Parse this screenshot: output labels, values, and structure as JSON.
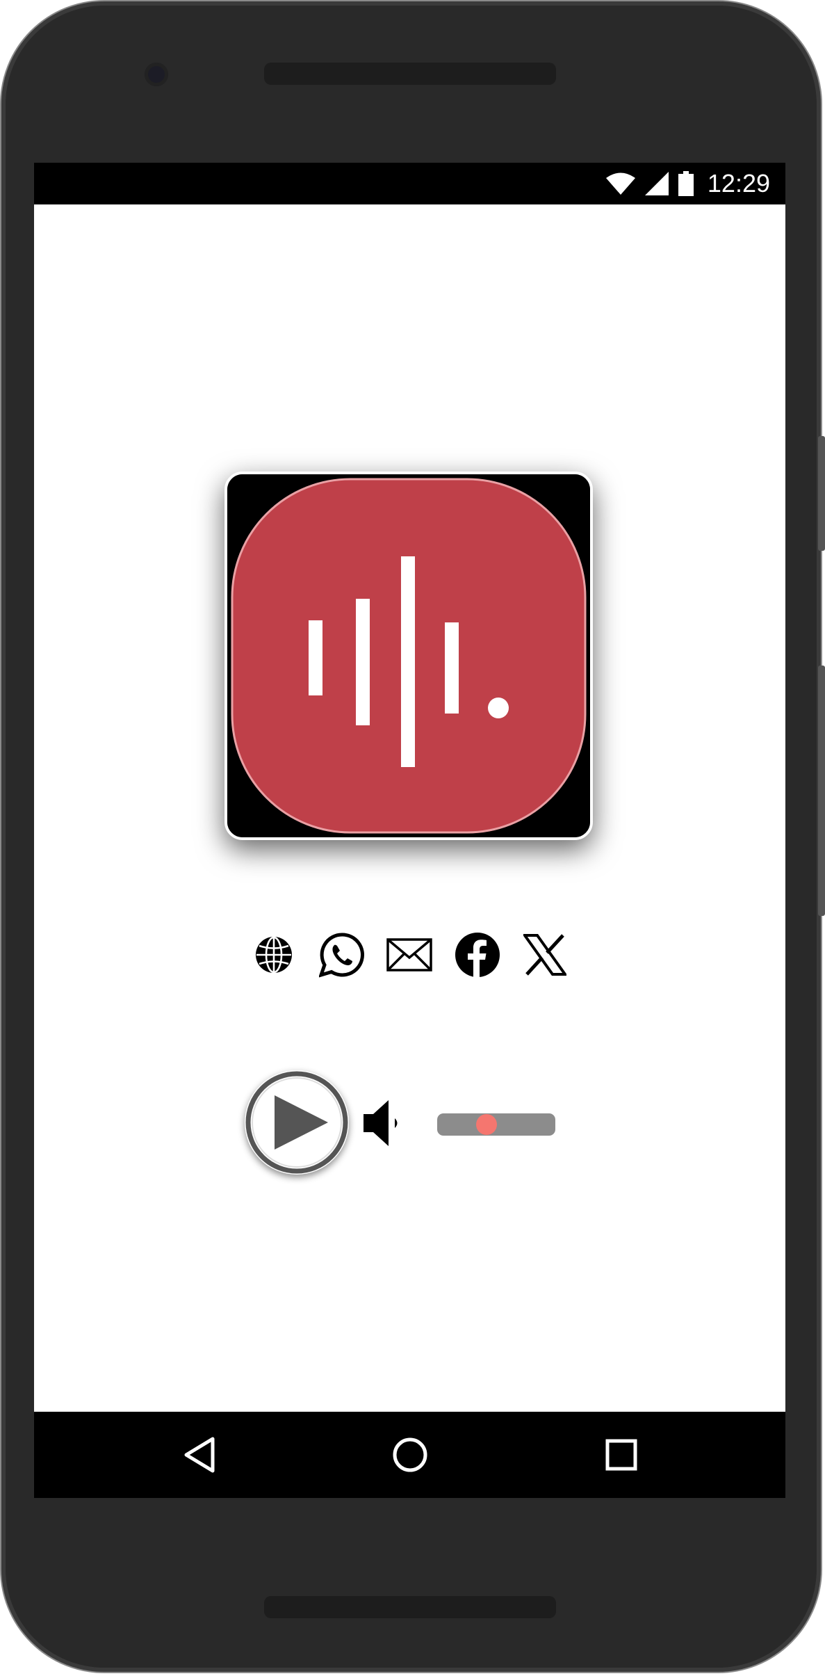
{
  "status_bar": {
    "time": "12:29",
    "icons": [
      "wifi-icon",
      "signal-icon",
      "battery-icon"
    ]
  },
  "logo": {
    "icon": "radio-waveform-logo",
    "background_color": "#bf4049",
    "mark_color": "#ffffff"
  },
  "social": {
    "items": [
      {
        "name": "website-globe-icon"
      },
      {
        "name": "whatsapp-icon"
      },
      {
        "name": "email-icon"
      },
      {
        "name": "facebook-icon"
      },
      {
        "name": "x-twitter-icon"
      }
    ]
  },
  "player": {
    "play_icon": "play-icon",
    "volume_icon": "speaker-icon",
    "volume_level": 0.42,
    "track_color": "#8c8c8c",
    "thumb_color": "#f5766f",
    "play_color": "#555555"
  },
  "nav_bar": {
    "buttons": [
      "back-icon",
      "home-icon",
      "recents-icon"
    ]
  }
}
